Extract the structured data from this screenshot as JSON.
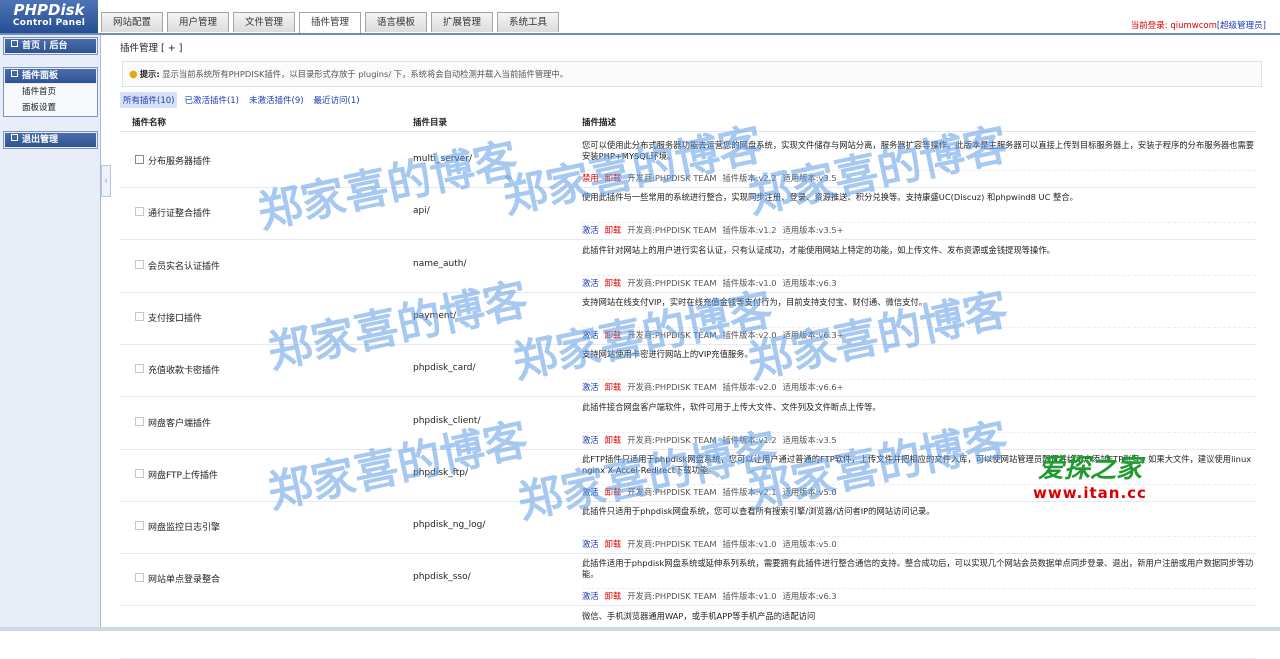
{
  "header": {
    "logo_line1": "PHPDisk",
    "logo_line2": "Control Panel",
    "tabs": [
      "网站配置",
      "用户管理",
      "文件管理",
      "插件管理",
      "语言模板",
      "扩展管理",
      "系统工具"
    ],
    "login_prefix": "当前登录:",
    "login_user": "qiumwcom",
    "login_role": "[超级管理员]"
  },
  "sidebar": {
    "box1": {
      "title": "首页 | 后台"
    },
    "box2": {
      "title": "插件面板",
      "items": [
        "插件首页",
        "面板设置"
      ]
    },
    "box3": {
      "title": "退出管理"
    }
  },
  "main": {
    "title": "插件管理 [ + ]",
    "tip_label": "提示:",
    "tip_text": "显示当前系统所有PHPDISK插件，以目录形式存放于 plugins/ 下，系统将会自动检测并载入当前插件管理中。",
    "filters": [
      "所有插件(10)",
      "已激活插件(1)",
      "未激活插件(9)",
      "最近访问(1)"
    ],
    "columns": {
      "name": "插件名称",
      "dir": "插件目录",
      "desc": "插件描述"
    },
    "plugins": [
      {
        "name": "分布服务器插件",
        "dir": "multi_server/",
        "desc": "您可以使用此分布式服务器功能去运营您的网盘系统，实现文件储存与网站分离，服务器扩容等操作。此版本是主服务器可以直接上传到目标服务器上，安装子程序的分布服务器也需要安装PHP+MYSQL环境。",
        "status1": "禁用",
        "status2": "卸载",
        "developer": "开发商:PHPDISK TEAM",
        "version": "插件版本:v2.2",
        "applies": "适用版本:v3.5"
      },
      {
        "name": "通行证整合插件",
        "dir": "api/",
        "desc": "使用此插件与一些常用的系统进行整合，实现同步注册、登录、资源推送、积分兑换等。支持康盛UC(Discuz) 和phpwind8 UC 整合。",
        "status1": "激活",
        "status2": "卸载",
        "developer": "开发商:PHPDISK TEAM",
        "version": "插件版本:v1.2",
        "applies": "适用版本:v3.5+"
      },
      {
        "name": "会员实名认证插件",
        "dir": "name_auth/",
        "desc": "此插件针对网站上的用户进行实名认证，只有认证成功，才能使用网站上特定的功能，如上传文件、发布资源或金钱提现等操作。",
        "status1": "激活",
        "status2": "卸载",
        "developer": "开发商:PHPDISK TEAM",
        "version": "插件版本:v1.0",
        "applies": "适用版本:v6.3"
      },
      {
        "name": "支付接口插件",
        "dir": "payment/",
        "desc": "支持网站在线支付VIP，实时在线充值金钱等支付行为，目前支持支付宝、财付通、微信支付。",
        "status1": "激活",
        "status2": "卸载",
        "developer": "开发商:PHPDISK TEAM",
        "version": "插件版本:v2.0",
        "applies": "适用版本:v6.3+"
      },
      {
        "name": "充值收款卡密插件",
        "dir": "phpdisk_card/",
        "desc": "支持网站使用卡密进行网站上的VIP充值服务。",
        "status1": "激活",
        "status2": "卸载",
        "developer": "开发商:PHPDISK TEAM",
        "version": "插件版本:v2.0",
        "applies": "适用版本:v6.6+"
      },
      {
        "name": "网盘客户端插件",
        "dir": "phpdisk_client/",
        "desc": "此插件接合网盘客户端软件，软件可用于上传大文件、文件列及文件断点上传等。",
        "status1": "激活",
        "status2": "卸载",
        "developer": "开发商:PHPDISK TEAM",
        "version": "插件版本:v1.2",
        "applies": "适用版本:v3.5"
      },
      {
        "name": "网盘FTP上传插件",
        "dir": "phpdisk_ftp/",
        "desc": "此FTP插件只适用于phpdisk网盘系统，您可以让用户通过普通的FTP软件，上传文件并把相应的文件入库，可以使网站管理员配置并给用户添加FTP账号。如果大文件，建议使用linux nginx X-Accel-Redirect下载功能。",
        "status1": "激活",
        "status2": "卸载",
        "developer": "开发商:PHPDISK TEAM",
        "version": "插件版本:v2.1",
        "applies": "适用版本:v5.0"
      },
      {
        "name": "网盘监控日志引擎",
        "dir": "phpdisk_ng_log/",
        "desc": "此插件只适用于phpdisk网盘系统，您可以查看所有搜索引擎/浏览器/访问者IP的网站访问记录。",
        "status1": "激活",
        "status2": "卸载",
        "developer": "开发商:PHPDISK TEAM",
        "version": "插件版本:v1.0",
        "applies": "适用版本:v5.0"
      },
      {
        "name": "网站单点登录整合",
        "dir": "phpdisk_sso/",
        "desc": "此插件适用于phpdisk网盘系统或延伸系列系统，需要拥有此插件进行整合通信的支持。整合成功后，可以实现几个网站会员数据单点同步登录、退出，新用户注册或用户数据同步等功能。",
        "status1": "激活",
        "status2": "卸载",
        "developer": "开发商:PHPDISK TEAM",
        "version": "插件版本:v1.0",
        "applies": "适用版本:v6.3"
      },
      {
        "name": "",
        "dir": "",
        "desc": "微信、手机浏览器通用WAP，或手机APP等手机产品的适配访问",
        "status1": "",
        "status2": "",
        "developer": "",
        "version": "",
        "applies": ""
      }
    ]
  },
  "watermark": {
    "text": "郑家喜的博客",
    "logo_cn": "爱探之家",
    "logo_url": "www.itan.cc"
  },
  "colors": {
    "brand": "#2f5292",
    "link": "#1e3cb0",
    "danger": "#dd0000",
    "watermark": "#5e9de6"
  }
}
